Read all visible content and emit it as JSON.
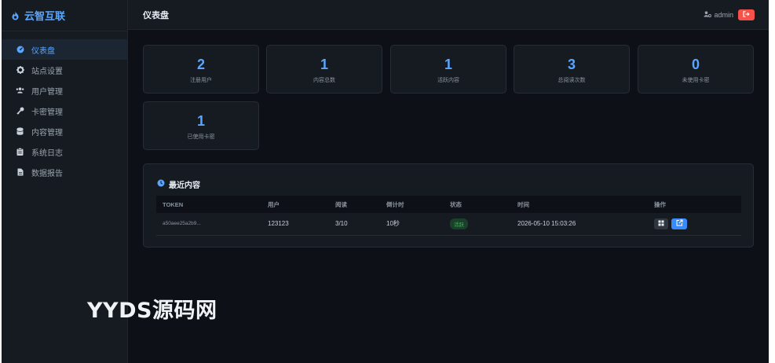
{
  "brand": {
    "name": "云智互联",
    "icon": "flame-icon"
  },
  "sidebar": {
    "items": [
      {
        "label": "仪表盘",
        "icon": "dashboard-icon",
        "active": true
      },
      {
        "label": "站点设置",
        "icon": "gear-icon"
      },
      {
        "label": "用户管理",
        "icon": "users-icon"
      },
      {
        "label": "卡密管理",
        "icon": "key-icon"
      },
      {
        "label": "内容管理",
        "icon": "database-icon"
      },
      {
        "label": "系统日志",
        "icon": "clipboard-icon"
      },
      {
        "label": "数据报告",
        "icon": "file-icon"
      }
    ]
  },
  "header": {
    "title": "仪表盘",
    "user": "admin"
  },
  "stats": [
    {
      "value": "2",
      "label": "注册用户"
    },
    {
      "value": "1",
      "label": "内容总数"
    },
    {
      "value": "1",
      "label": "活跃内容"
    },
    {
      "value": "3",
      "label": "总阅读次数"
    },
    {
      "value": "0",
      "label": "未使用卡密"
    },
    {
      "value": "1",
      "label": "已使用卡密"
    }
  ],
  "recent": {
    "title": "最近内容",
    "columns": [
      "TOKEN",
      "用户",
      "阅读",
      "倒计时",
      "状态",
      "时间",
      "操作"
    ],
    "rows": [
      {
        "token": "a50aee25a2b9...",
        "user": "123123",
        "reads": "3/10",
        "countdown": "10秒",
        "status": "活跃",
        "time": "2026-05-10 15:03:26"
      }
    ]
  },
  "watermark": "YYDS源码网",
  "colors": {
    "accent": "#58a6ff",
    "danger": "#f85149",
    "success": "#3fb950",
    "bg": "#0d1117",
    "panel": "#161b22"
  }
}
